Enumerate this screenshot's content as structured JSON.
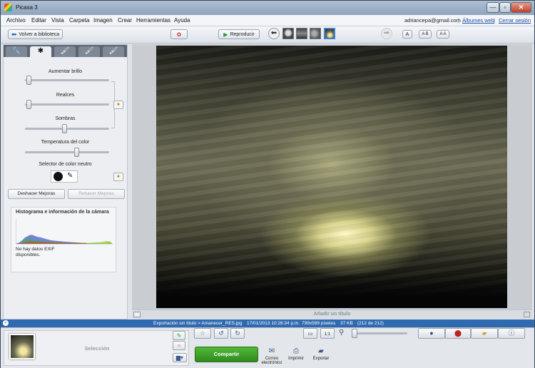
{
  "window": {
    "title": "Picasa 3",
    "min": "—",
    "max": "▫",
    "close": "✕"
  },
  "menu": [
    "Archivo",
    "Editar",
    "Vista",
    "Carpeta",
    "Imagen",
    "Crear",
    "Herramientas",
    "Ayuda"
  ],
  "account": {
    "email": "adriancepa@gmail.com",
    "sep": "|",
    "web_albums": "Álbumes web",
    "sign_out": "Cerrar sesión"
  },
  "toolbar": {
    "back": "Volver a biblioteca",
    "play": "Reproducir",
    "text_a": "A",
    "text_ab": "A B",
    "text_aa": "A A"
  },
  "tabs": [
    "🔧",
    "✱",
    "🖌",
    "🖌",
    "🖌"
  ],
  "tuning": {
    "brightness": {
      "label": "Aumentar brillo",
      "value": 0.02
    },
    "highlights": {
      "label": "Realces",
      "value": 0.02
    },
    "shadows": {
      "label": "Sombras",
      "value": 0.47
    },
    "temperature": {
      "label": "Temperatura del color",
      "value": 0.63
    },
    "neutral": {
      "label": "Selector de color neutro"
    }
  },
  "buttons": {
    "undo": "Deshacer Mejoras",
    "redo": "Rehacer Mejoras"
  },
  "histogram": {
    "title": "Histograma e información de la cámara",
    "no_exif": "No hay datos EXIF disponibles."
  },
  "caption": {
    "placeholder": "Añadir un título"
  },
  "status": {
    "path": "Exportación sin título > Amanecer_RES.jpg",
    "date": "17/01/2013 10:26:34 p.m.",
    "dims": "799x599 píxeles",
    "size": "37 KB",
    "count": "(212 de 212)"
  },
  "bottom": {
    "selection": "Selección",
    "share": "Compartir",
    "email": "Correo electrónico",
    "print": "Imprimir",
    "export": "Exportar"
  },
  "colors": {
    "accent": "#2f6ab1",
    "share_green": "#3f9b2a"
  }
}
